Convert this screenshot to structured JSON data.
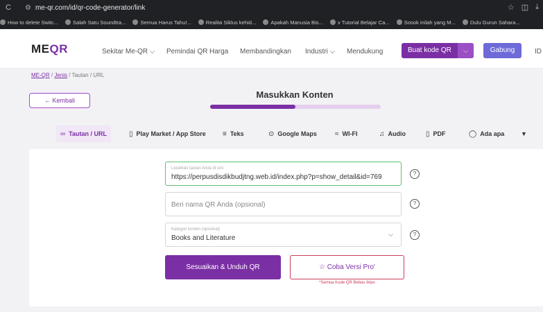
{
  "browser": {
    "url": "me-qr.com/id/qr-code-generator/link",
    "bookmarks": [
      "How to delete Switc...",
      "Salah Satu Soundtra...",
      "Semua Harus Tahu!...",
      "Realita Siklus kehid...",
      "Apakah Manusia Bis...",
      "v Tutorial Belajar Ca...",
      "Sosok inilah yang M...",
      "Dulu Gurun Sahara..."
    ]
  },
  "header": {
    "logo_me": "ME",
    "logo_qr": "QR",
    "nav": [
      "Sekitar Me-QR ⌵",
      "Pemindai QR",
      "Harga",
      "Membandingkan",
      "Industri ⌵",
      "Mendukung"
    ],
    "make_button": "Buat kode QR",
    "join_button": "Gabung",
    "lang": "ID"
  },
  "breadcrumb": {
    "root": "ME-QR",
    "sep": "/",
    "types": "Jenis",
    "current": "Tautan / URL"
  },
  "back_button": "← Kembali",
  "step": {
    "title": "Masukkan Konten",
    "progress": 0.5
  },
  "tabs": [
    {
      "icon": "∞",
      "label": "Tautan / URL"
    },
    {
      "icon": "▯",
      "label": "Play Market / App Store"
    },
    {
      "icon": "≡",
      "label": "Teks"
    },
    {
      "icon": "⊙",
      "label": "Google Maps"
    },
    {
      "icon": "≈",
      "label": "WI-FI"
    },
    {
      "icon": "♫",
      "label": "Audio"
    },
    {
      "icon": "▯",
      "label": "PDF"
    },
    {
      "icon": "◯",
      "label": "Ada apa"
    }
  ],
  "form": {
    "link_label": "Letakkan tautan Anda di sini",
    "link_value": "https://perpusdisdikbudjtng.web.id/index.php?p=show_detail&id=769",
    "name_placeholder": "Beri nama QR Anda (opsional)",
    "category_label": "Kategori konten (opsional)",
    "category_value": "Books and Literature",
    "help": "?"
  },
  "save_button": "Sesuaikan & Unduh QR",
  "pro_button": "☆ Coba Versi Pro'",
  "pro_note": "*Semua Kode QR Bebas Iklan"
}
